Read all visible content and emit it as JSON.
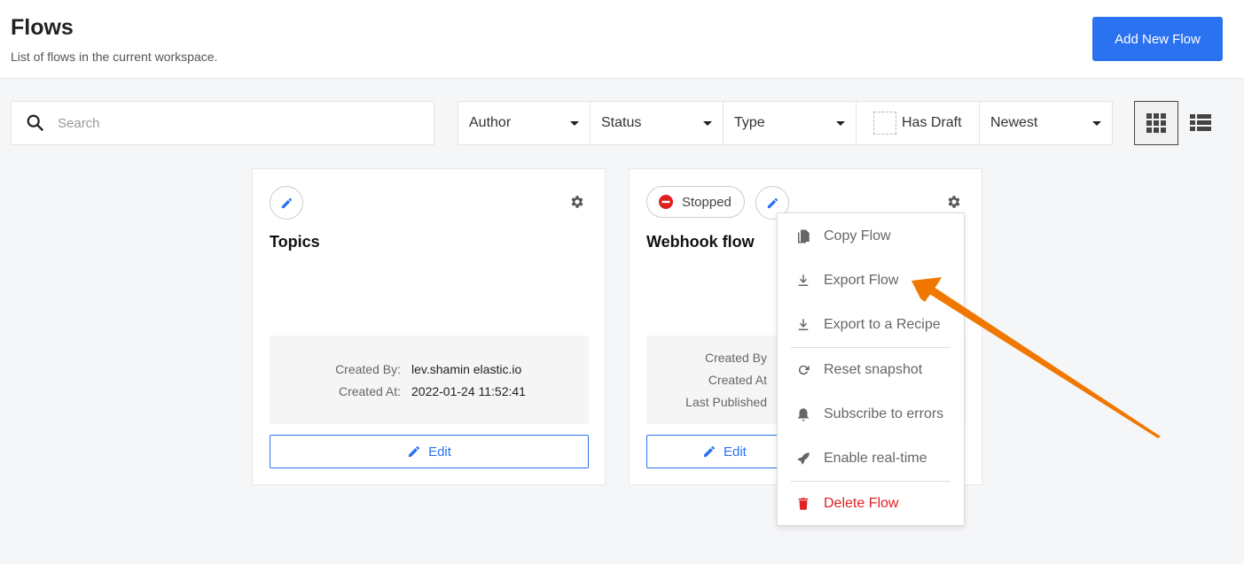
{
  "header": {
    "title": "Flows",
    "subtitle": "List of flows in the current workspace.",
    "add_button": "Add New Flow"
  },
  "toolbar": {
    "search_placeholder": "Search",
    "filters": {
      "author": "Author",
      "status": "Status",
      "type": "Type",
      "has_draft": "Has Draft",
      "sort": "Newest"
    },
    "view": "grid"
  },
  "cards": [
    {
      "title": "Topics",
      "created_by_label": "Created By:",
      "created_by": "lev.shamin elastic.io",
      "created_at_label": "Created At:",
      "created_at": "2022-01-24 11:52:41",
      "edit": "Edit"
    },
    {
      "title": "Webhook flow",
      "status": "Stopped",
      "created_by_label": "Created By",
      "created_at_label": "Created At",
      "last_published_label": "Last Published",
      "edit": "Edit"
    }
  ],
  "menu": {
    "items": [
      "Copy Flow",
      "Export Flow",
      "Export to a Recipe",
      "Reset snapshot",
      "Subscribe to errors",
      "Enable real-time",
      "Delete Flow"
    ]
  },
  "colors": {
    "accent": "#2a72f0",
    "danger": "#e02020",
    "annotation_arrow": "#f07800"
  }
}
